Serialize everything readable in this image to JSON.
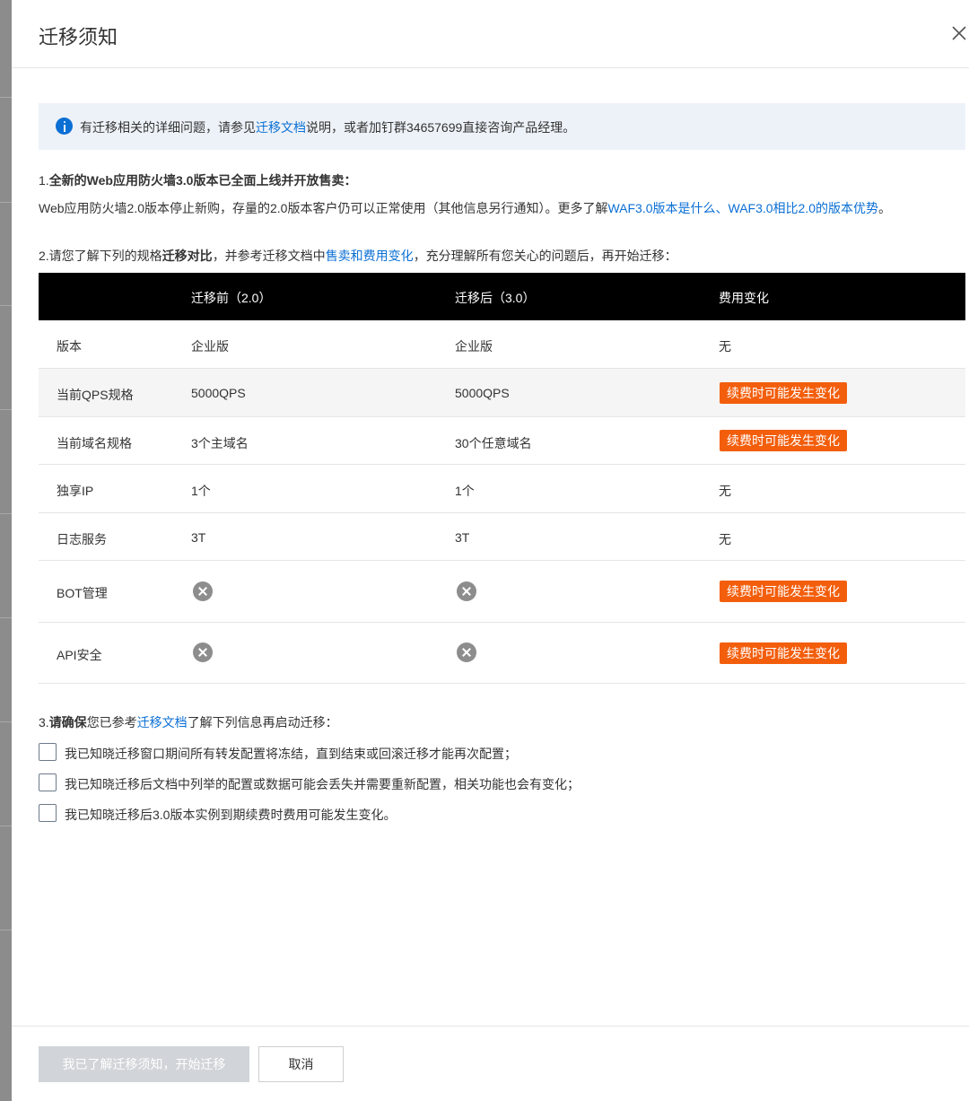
{
  "drawer": {
    "title": "迁移须知"
  },
  "info": {
    "text_before": "有迁移相关的详细问题，请参见",
    "link": "迁移文档",
    "text_after": "说明，或者加钉群34657699直接咨询产品经理。"
  },
  "section1": {
    "prefix": "1.",
    "title_bold": "全新的Web应用防火墙3.0版本已全面上线并开放售卖",
    "suffix": "：",
    "desc_before": "Web应用防火墙2.0版本停止新购，存量的2.0版本客户仍可以正常使用（其他信息另行通知）。更多了解",
    "link1": "WAF3.0版本是什么",
    "separator": "、",
    "link2": "WAF3.0相比2.0的版本优势",
    "desc_after": "。"
  },
  "section2": {
    "text_before": "2.请您了解下列的规格",
    "bold": "迁移对比",
    "text_mid": "，并参考迁移文档中",
    "link": "售卖和费用变化",
    "text_after": "，充分理解所有您关心的问题后，再开始迁移："
  },
  "table": {
    "headers": [
      "",
      "迁移前（2.0）",
      "迁移后（3.0）",
      "费用变化"
    ],
    "rows": [
      {
        "name": "版本",
        "before": "企业版",
        "after": "企业版",
        "cost": "无",
        "cost_tag": false
      },
      {
        "name": "当前QPS规格",
        "before": "5000QPS",
        "after": "5000QPS",
        "cost": "续费时可能发生变化",
        "cost_tag": true
      },
      {
        "name": "当前域名规格",
        "before": "3个主域名",
        "after": "30个任意域名",
        "cost": "续费时可能发生变化",
        "cost_tag": true
      },
      {
        "name": "独享IP",
        "before": "1个",
        "after": "1个",
        "cost": "无",
        "cost_tag": false
      },
      {
        "name": "日志服务",
        "before": "3T",
        "after": "3T",
        "cost": "无",
        "cost_tag": false
      },
      {
        "name": "BOT管理",
        "before_icon": "close-circle-icon",
        "after_icon": "close-circle-icon",
        "cost": "续费时可能发生变化",
        "cost_tag": true
      },
      {
        "name": "API安全",
        "before_icon": "close-circle-icon",
        "after_icon": "close-circle-icon",
        "cost": "续费时可能发生变化",
        "cost_tag": true
      }
    ],
    "tag_color": "#f35e0c"
  },
  "section3": {
    "prefix": "3.",
    "bold": "请确保",
    "text_mid": "您已参考",
    "link": "迁移文档",
    "text_after": "了解下列信息再启动迁移：",
    "checks": [
      "我已知晓迁移窗口期间所有转发配置将冻结，直到结束或回滚迁移才能再次配置；",
      "我已知晓迁移后文档中列举的配置或数据可能会丢失并需要重新配置，相关功能也会有变化；",
      "我已知晓迁移后3.0版本实例到期续费时费用可能发生变化。"
    ]
  },
  "footer": {
    "confirm_label": "我已了解迁移须知，开始迁移",
    "cancel_label": "取消"
  },
  "colors": {
    "link": "#0b6fd4",
    "table_header_bg": "#000000",
    "info_bg": "#edf2f8"
  }
}
